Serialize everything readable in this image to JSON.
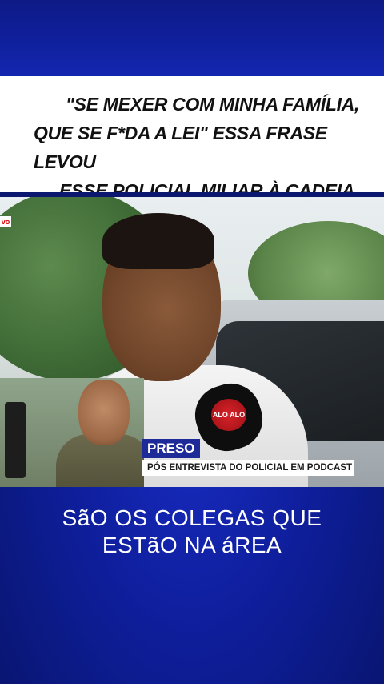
{
  "headline": {
    "line1": "\"SE MEXER COM MINHA FAMÍLIA,",
    "line2": "QUE SE F*DA A LEI\" ESSA FRASE LEVOU",
    "line3": "ESSE POLICIAL MILIAR À CADEIA"
  },
  "video": {
    "live_tag": "vo",
    "mic_logo": "ALO ALO",
    "lower_third": {
      "tag": "PRESO",
      "text": "PÓS ENTREVISTA DO POLICIAL EM PODCAST"
    }
  },
  "caption": {
    "line1": "SãO OS COLEGAS QUE",
    "line2": "ESTãO NA áREA"
  },
  "colors": {
    "background": "#1326b0",
    "lower_third_tag": "#1f2a99",
    "mic_logo": "#d8232a"
  }
}
